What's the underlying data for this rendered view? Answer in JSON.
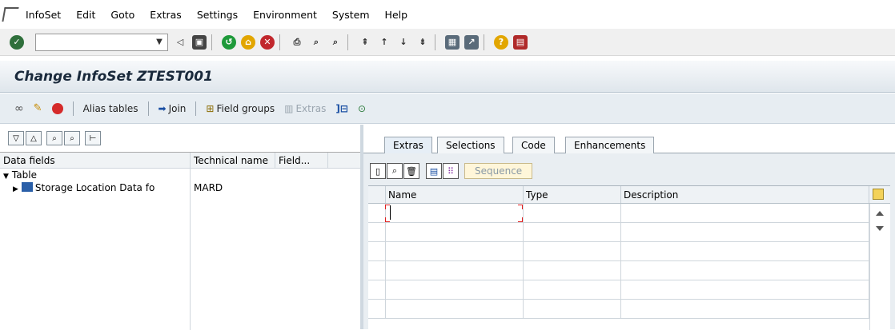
{
  "menu": {
    "items": [
      "InfoSet",
      "Edit",
      "Goto",
      "Extras",
      "Settings",
      "Environment",
      "System",
      "Help"
    ]
  },
  "toolbar": {
    "command_field_value": "",
    "icons": [
      "enter-icon",
      "back-icon",
      "save-icon",
      "exit-icon",
      "cancel-icon",
      "print-icon",
      "find-icon",
      "find-next-icon",
      "first-page-icon",
      "prev-page-icon",
      "next-page-icon",
      "last-page-icon",
      "create-session-icon",
      "shortcut-icon",
      "help-icon",
      "customize-layout-icon"
    ]
  },
  "title": "Change InfoSet ZTEST001",
  "app_toolbar": {
    "alias_tables": "Alias tables",
    "join": "Join",
    "field_groups": "Field groups",
    "extras": "Extras"
  },
  "left_tree": {
    "headers": [
      "Data fields",
      "Technical name",
      "Field..."
    ],
    "rows": [
      {
        "label": "Table",
        "tech": ""
      },
      {
        "label": "Storage Location Data fo",
        "tech": "MARD"
      }
    ]
  },
  "tabs": [
    "Extras",
    "Selections",
    "Code",
    "Enhancements"
  ],
  "active_tab": "Extras",
  "extras_grid": {
    "sequence_button": "Sequence",
    "headers": [
      "Name",
      "Type",
      "Description"
    ]
  }
}
